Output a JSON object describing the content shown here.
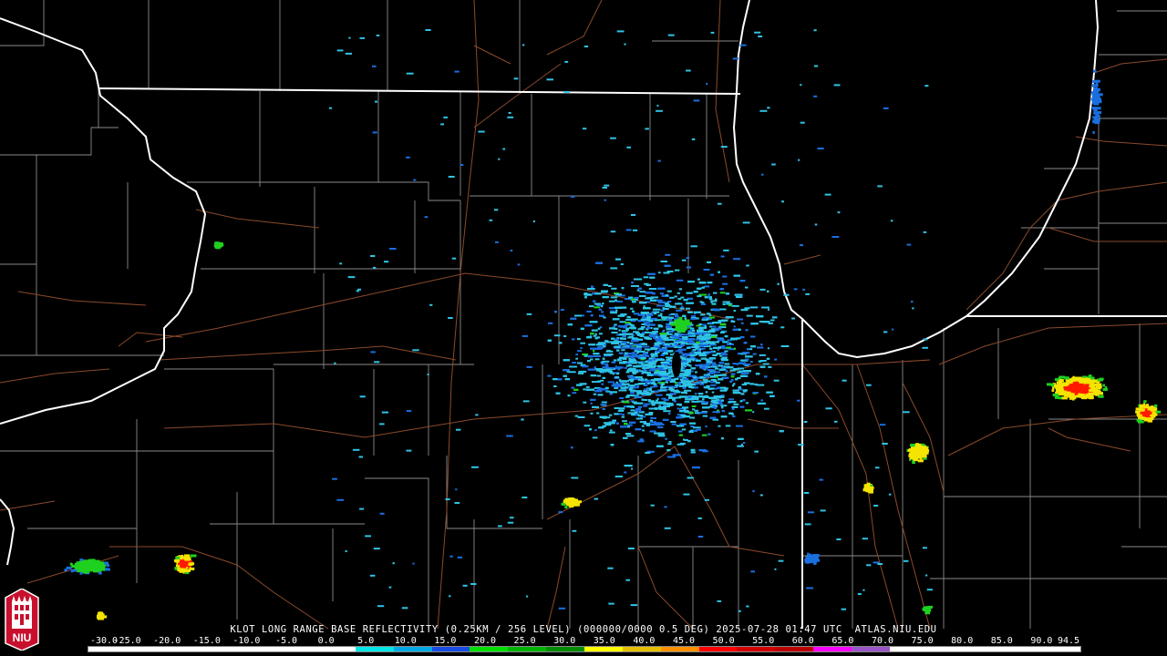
{
  "header": {
    "caption": "KLOT LONG RANGE BASE REFLECTIVITY (0.25KM / 256 LEVEL) (000000/0000 0.5 DEG) 2025-07-28 01:47 UTC  ATLAS.NIU.EDU"
  },
  "scale": {
    "labels": [
      "-30.0",
      "-25.0",
      "-20.0",
      "-15.0",
      "-10.0",
      "-5.0",
      "0.0",
      "5.0",
      "10.0",
      "15.0",
      "20.0",
      "25.0",
      "30.0",
      "35.0",
      "40.0",
      "45.0",
      "50.0",
      "55.0",
      "60.0",
      "65.0",
      "70.0",
      "75.0",
      "80.0",
      "85.0",
      "90.0",
      "94.5"
    ],
    "colors": [
      "#ffffff",
      "#ffffff",
      "#ffffff",
      "#ffffff",
      "#ffffff",
      "#ffffff",
      "#ffffff",
      "#00e5e5",
      "#00a9e5",
      "#1a4be5",
      "#00e000",
      "#00b400",
      "#008c00",
      "#ffff00",
      "#e6c000",
      "#ff9000",
      "#ff0000",
      "#d40000",
      "#bc0000",
      "#ff00ff",
      "#9955c9",
      "#ffffff",
      "#ffffff",
      "#ffffff",
      "#ffffff",
      "#ffffff"
    ]
  },
  "logo": {
    "text": "NIU",
    "colors": {
      "shield": "#c8102e",
      "tower": "#ffffff"
    }
  },
  "map": {
    "background": "#000000",
    "colors": {
      "state_border": "#ffffff",
      "shoreline": "#ffffff",
      "county_line": "#9a9a9a",
      "highway": "#8b4a2b",
      "echo_light": "#2ec4e6",
      "echo_mid": "#1a6fe0",
      "echo_green": "#1fd11f",
      "echo_yellow": "#f4e400",
      "echo_red": "#ff1a00"
    }
  }
}
